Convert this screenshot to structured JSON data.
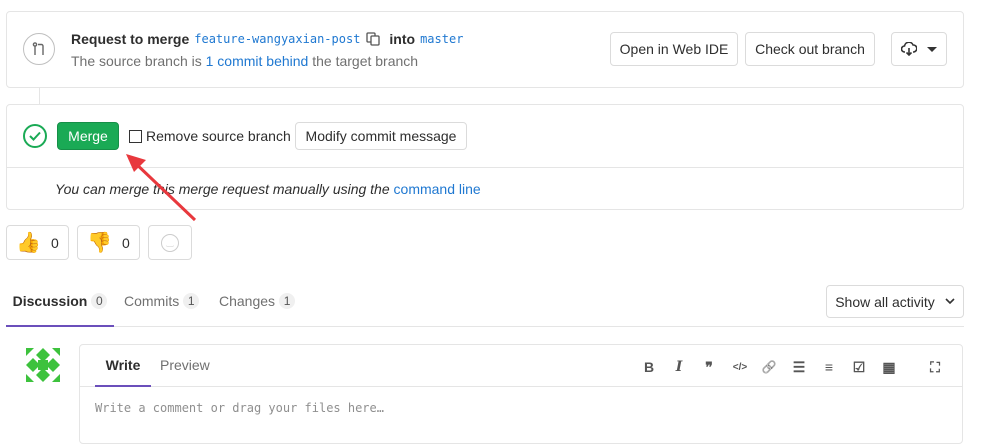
{
  "widget": {
    "request_label": "Request to merge",
    "source_branch": "feature-wangyaxian-post",
    "into_label": "into",
    "target_branch": "master",
    "status_prefix": "The source branch is",
    "status_link": "1 commit behind",
    "status_suffix": "the target branch",
    "open_web_ide": "Open in Web IDE",
    "check_out_branch": "Check out branch"
  },
  "merge": {
    "merge_button": "Merge",
    "remove_source_branch": "Remove source branch",
    "modify_commit_message": "Modify commit message",
    "hint_text": "You can merge this merge request manually using the",
    "hint_link": "command line"
  },
  "reactions": {
    "thumbs_up_count": "0",
    "thumbs_down_count": "0"
  },
  "tabs": [
    {
      "label": "Discussion",
      "count": "0",
      "active": true
    },
    {
      "label": "Commits",
      "count": "1"
    },
    {
      "label": "Changes",
      "count": "1"
    }
  ],
  "activity_filter": "Show all activity",
  "editor": {
    "write_tab": "Write",
    "preview_tab": "Preview",
    "placeholder": "Write a comment or drag your files here…",
    "toolbar": {
      "bold": "B",
      "italic": "I",
      "quote": "❞",
      "code": "</>",
      "link": "🔗",
      "bullet": "☰",
      "numbered": "≡",
      "task": "☑",
      "table": "▦",
      "fullscreen": "⛶"
    }
  },
  "colors": {
    "merge_green": "#1aaa55",
    "link_blue": "#1f78d1",
    "active_tab_underline": "#6b4fbb",
    "arrow_red": "#e8383d"
  }
}
